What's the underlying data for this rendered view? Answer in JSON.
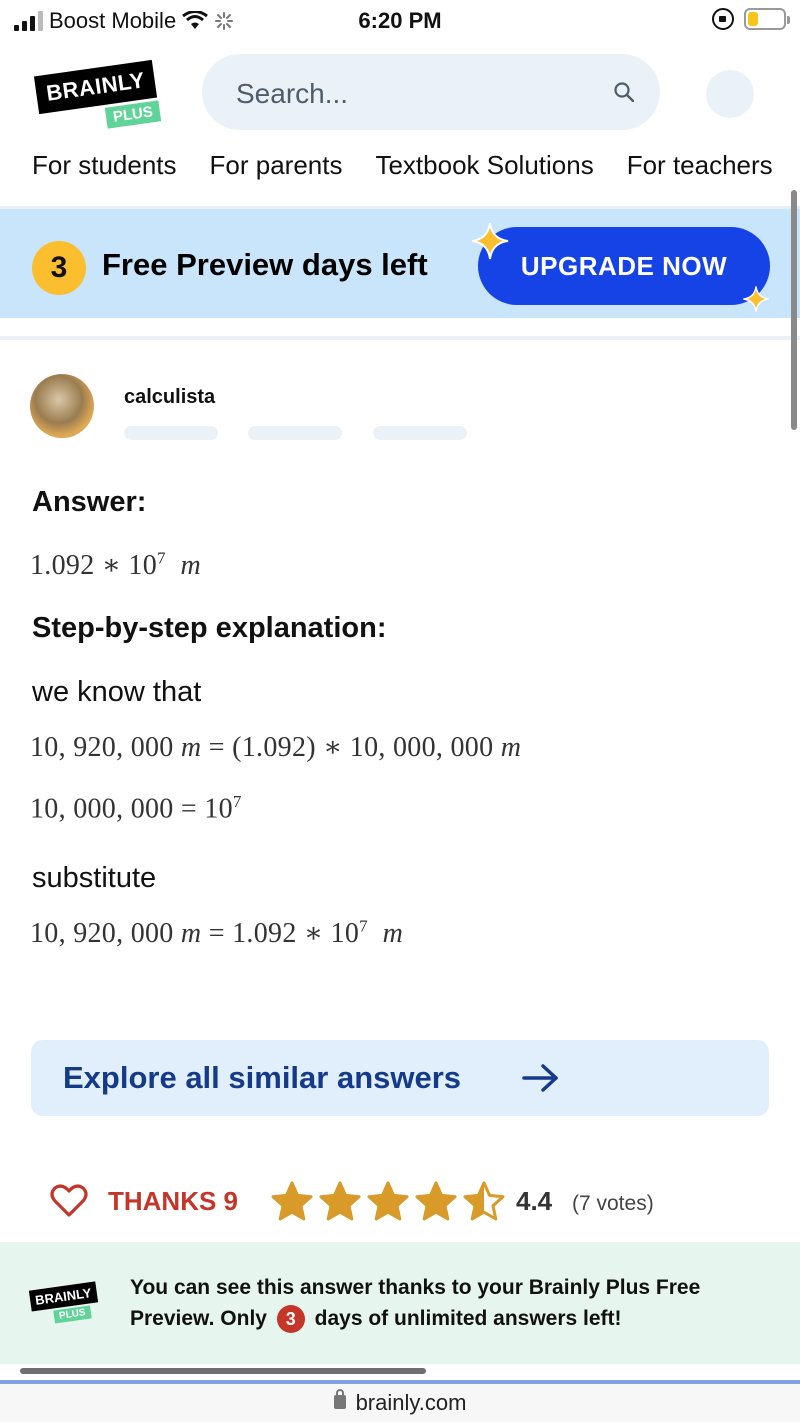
{
  "status_bar": {
    "carrier": "Boost Mobile",
    "time": "6:20 PM"
  },
  "header": {
    "logo_text": "BRAINLY",
    "logo_plus": "PLUS",
    "search_placeholder": "Search..."
  },
  "nav": {
    "items": [
      "For students",
      "For parents",
      "Textbook Solutions",
      "For teachers"
    ]
  },
  "banner": {
    "days": "3",
    "text": "Free Preview days left",
    "upgrade_label": "UPGRADE NOW"
  },
  "answer": {
    "author": "calculista",
    "answer_heading": "Answer:",
    "answer_value": {
      "mantissa": "1.092 ∗ 10",
      "exp": "7",
      "unit": "m"
    },
    "steps_heading": "Step-by-step explanation:",
    "line1_text": "we know that",
    "eq1": {
      "lhs": "10, 920, 000 ",
      "unit1": "m",
      "mid": " = (1.092) ∗ 10, 000, 000 ",
      "unit2": "m"
    },
    "eq2": {
      "lhs": "10, 000, 000 = 10",
      "exp": "7"
    },
    "line2_text": "substitute",
    "eq3": {
      "lhs": "10, 920, 000 ",
      "unit1": "m",
      "mid": " = 1.092 ∗ 10",
      "exp": "7",
      "unit2": "m"
    }
  },
  "explore": {
    "label": "Explore all similar answers"
  },
  "thanks": {
    "label": "THANKS 9",
    "rating": "4.4",
    "votes": "(7 votes)",
    "stars_filled": 4.4,
    "star_color": "#d89a29"
  },
  "notice": {
    "logo_text": "BRAINLY",
    "logo_plus": "PLUS",
    "text_before": "You can see this answer thanks to your Brainly Plus Free Preview. Only",
    "days": "3",
    "text_after": "days of unlimited answers left!"
  },
  "url_bar": {
    "url": "brainly.com"
  }
}
